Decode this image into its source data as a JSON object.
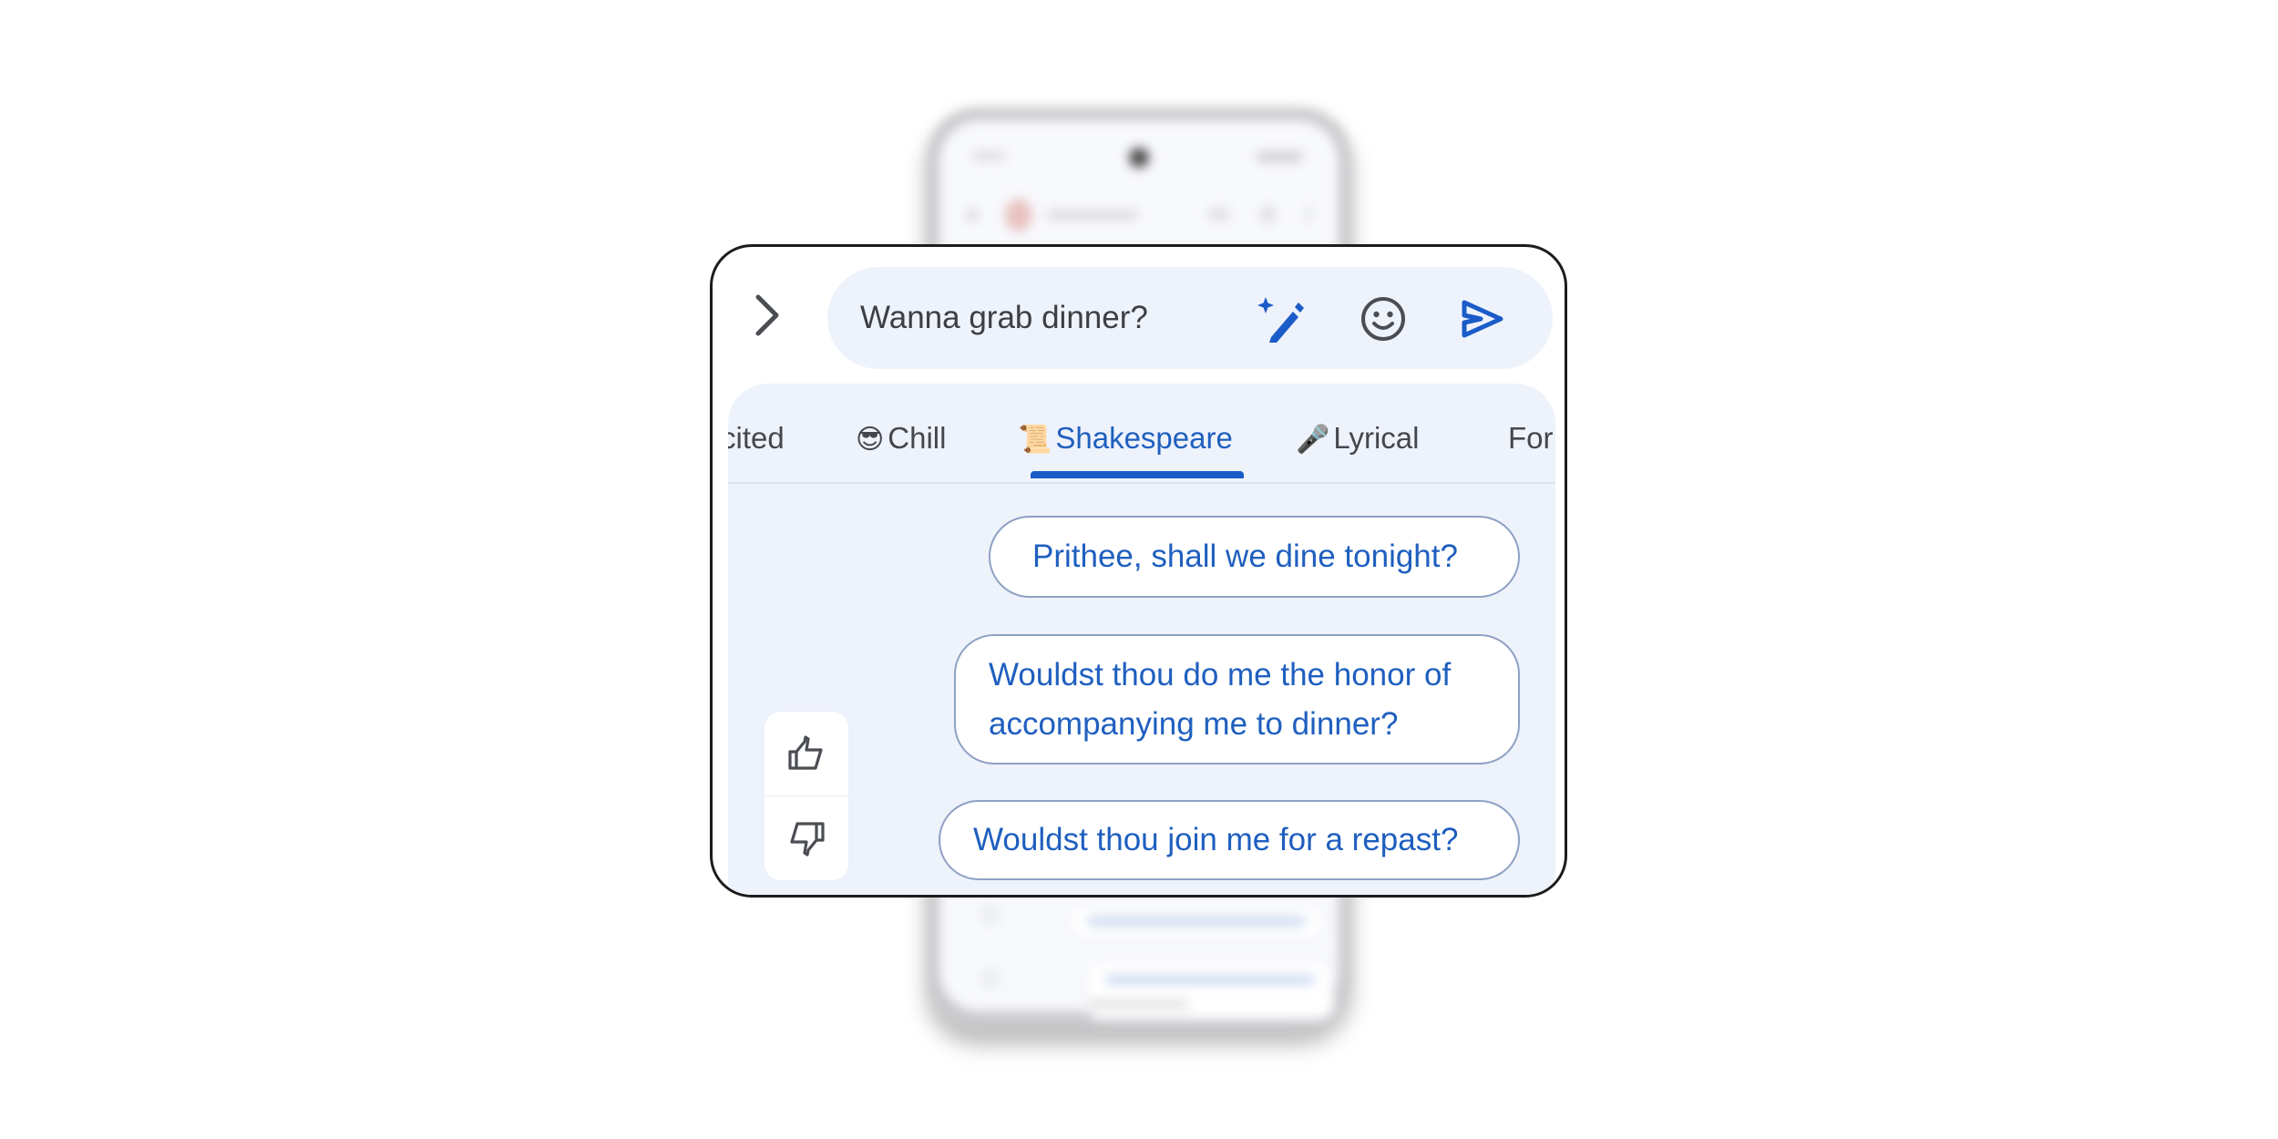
{
  "compose": {
    "value": "Wanna grab dinner?",
    "expand_icon": "chevron-right-icon",
    "magic_icon": "magic-wand-icon",
    "emoji_icon": "emoji-icon",
    "send_icon": "send-icon"
  },
  "tabs": {
    "active": "Shakespeare",
    "items": [
      {
        "label": "Excited",
        "visible_text": "cited",
        "emoji": ""
      },
      {
        "label": "Chill",
        "emoji": "😎"
      },
      {
        "label": "Shakespeare",
        "emoji": "📜"
      },
      {
        "label": "Lyrical",
        "emoji": "🎤"
      },
      {
        "label": "Formal",
        "visible_text": "For",
        "emoji": ""
      }
    ]
  },
  "suggestions": [
    "Prithee, shall we dine tonight?",
    "Wouldst thou do me the honor of accompanying me to dinner?",
    "Wouldst thou join me for a repast?"
  ],
  "feedback": {
    "up_icon": "thumbs-up-icon",
    "down_icon": "thumbs-down-icon"
  },
  "colors": {
    "accent": "#1a5cc8",
    "chip_text": "#1f5fbf",
    "panel_bg": "#eef2fb",
    "chip_border": "#8ea1c4",
    "card_border": "#1c1c1c"
  }
}
